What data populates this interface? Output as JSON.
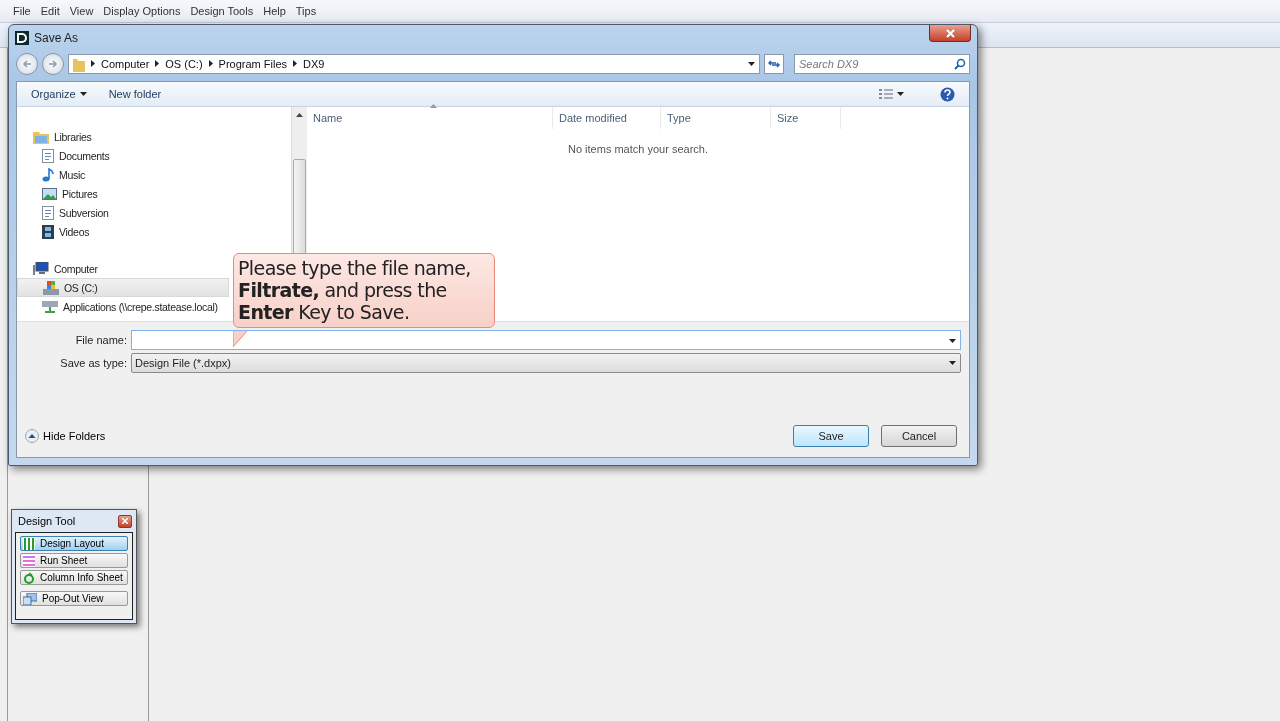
{
  "menu": [
    "File",
    "Edit",
    "View",
    "Display Options",
    "Design Tools",
    "Help",
    "Tips"
  ],
  "dialog": {
    "title": "Save As",
    "breadcrumb": [
      "Computer",
      "OS (C:)",
      "Program Files",
      "DX9"
    ],
    "search": {
      "placeholder": "Search DX9"
    },
    "toolbar": [
      {
        "label": "Organize",
        "dropdown": true
      },
      {
        "label": "New folder",
        "dropdown": false
      }
    ],
    "nav": [
      {
        "label": "Libraries",
        "kind": "library",
        "selected": false,
        "children": [
          {
            "label": "Documents",
            "kind": "document",
            "selected": false
          },
          {
            "label": "Music",
            "kind": "music",
            "selected": false
          },
          {
            "label": "Pictures",
            "kind": "pictures",
            "selected": false
          },
          {
            "label": "Subversion",
            "kind": "document",
            "selected": false
          },
          {
            "label": "Videos",
            "kind": "video",
            "selected": false
          }
        ]
      },
      {
        "label": "Computer",
        "kind": "computer",
        "selected": false,
        "children": [
          {
            "label": "OS (C:)",
            "kind": "drive",
            "selected": true
          },
          {
            "label": "Applications (\\\\crepe.statease.local)",
            "kind": "network",
            "selected": false
          }
        ]
      }
    ],
    "columns": [
      {
        "label": "Name",
        "sorted": true
      },
      {
        "label": "Date modified",
        "sorted": false
      },
      {
        "label": "Type",
        "sorted": false
      },
      {
        "label": "Size",
        "sorted": false
      }
    ],
    "empty_message": "No items match your search.",
    "file_name": {
      "label": "File name:"
    },
    "save_as_type": {
      "label": "Save as type:",
      "value": "Design File (*.dxpx)"
    },
    "hide_folders": "Hide Folders",
    "buttons": [
      {
        "label": "Save",
        "default": true
      },
      {
        "label": "Cancel",
        "default": false
      }
    ],
    "callout": "Please type the file name, **Filtrate,** and press the **Enter** Key to Save."
  },
  "design_tool": {
    "title": "Design Tool",
    "items": [
      {
        "label": "Design Layout",
        "kind": "layout",
        "selected": true
      },
      {
        "label": "Run Sheet",
        "kind": "sheet",
        "selected": false
      },
      {
        "label": "Column Info Sheet",
        "kind": "column",
        "selected": false
      },
      {
        "label": "Pop-Out View",
        "kind": "popout",
        "selected": false
      }
    ]
  }
}
